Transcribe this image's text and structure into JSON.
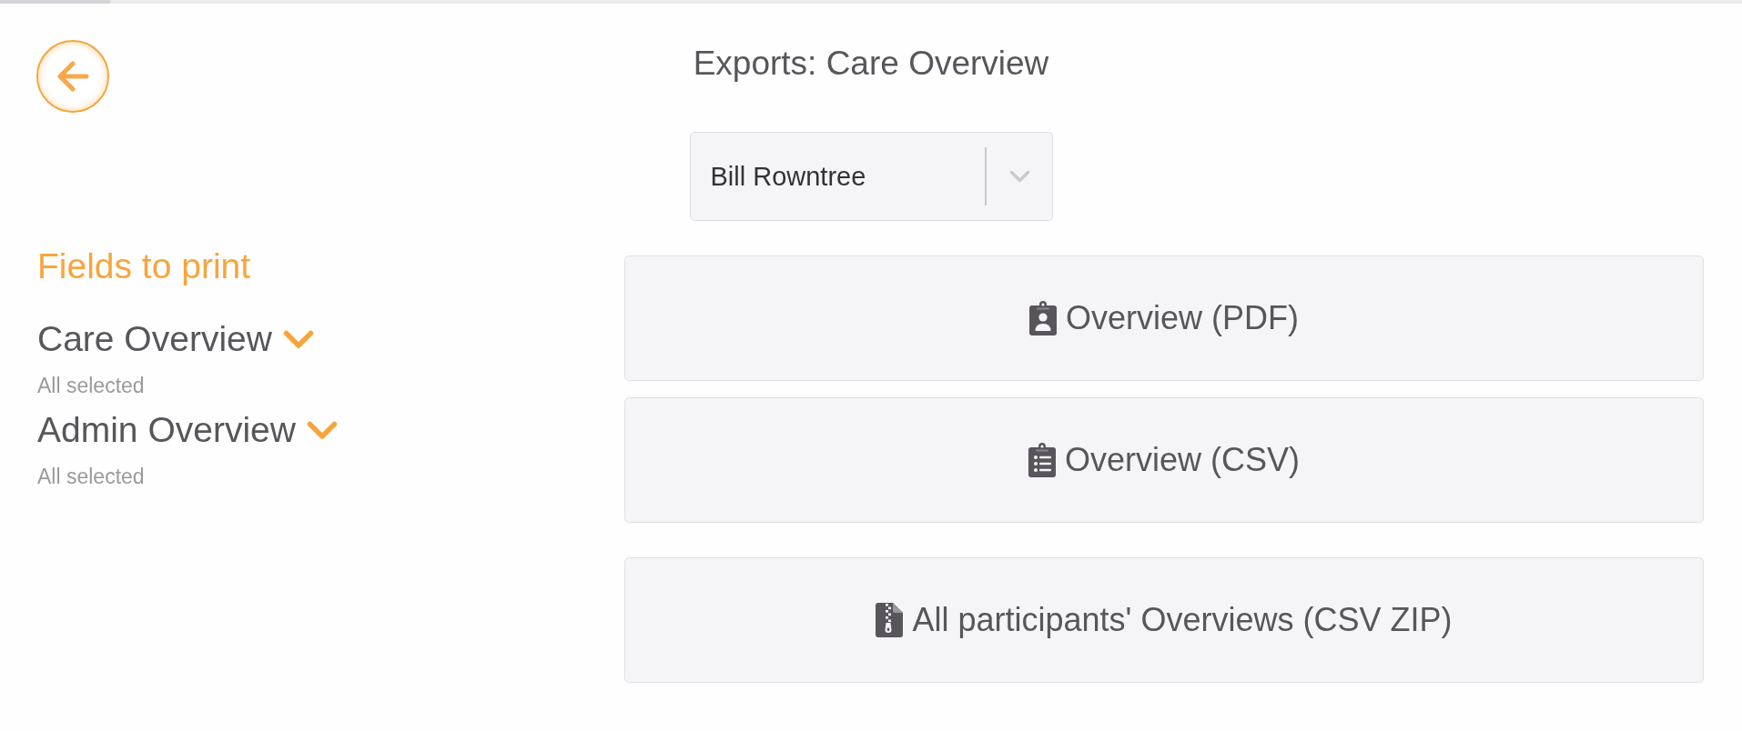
{
  "loading_bar": {
    "level": 0.063
  },
  "header": {
    "title": "Exports: Care Overview"
  },
  "participant_select": {
    "value": "Bill Rowntree"
  },
  "fields_to_print": {
    "title": "Fields to print",
    "groups": [
      {
        "label": "Care Overview",
        "summary": "All selected",
        "expanded": false
      },
      {
        "label": "Admin Overview",
        "summary": "All selected",
        "expanded": false
      }
    ]
  },
  "export_groups": [
    {
      "buttons": [
        {
          "kind": "pdf",
          "label": "Overview (PDF)"
        },
        {
          "kind": "csv",
          "label": "Overview (CSV)"
        }
      ]
    },
    {
      "buttons": [
        {
          "kind": "zip",
          "label": "All participants' Overviews (CSV ZIP)"
        }
      ]
    }
  ]
}
